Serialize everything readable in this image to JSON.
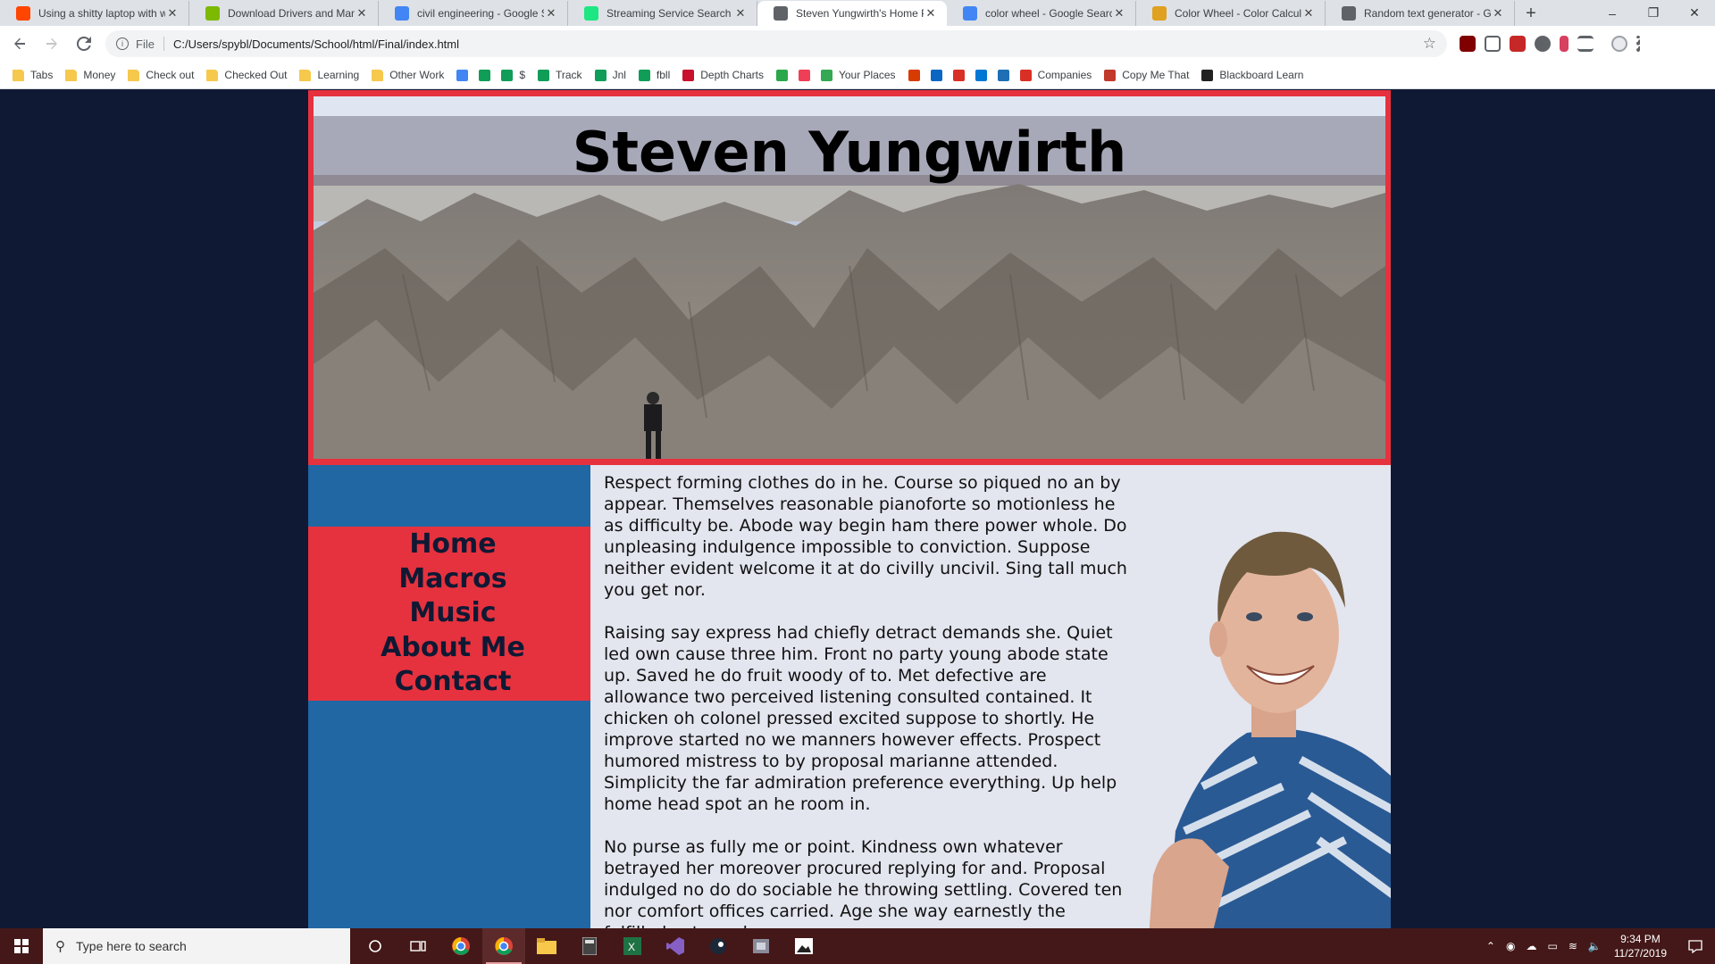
{
  "browser": {
    "tabs": [
      {
        "title": "Using a shitty laptop with w",
        "favicon_color": "#ff4500"
      },
      {
        "title": "Download Drivers and Man",
        "favicon_color": "#7cb900"
      },
      {
        "title": "civil engineering - Google S",
        "favicon_color": "#4285f4"
      },
      {
        "title": "Streaming Service Search E",
        "favicon_color": "#1ce783"
      },
      {
        "title": "Steven Yungwirth's Home P",
        "favicon_color": "#5f6368"
      },
      {
        "title": "color wheel - Google Search",
        "favicon_color": "#4285f4"
      },
      {
        "title": "Color Wheel - Color Calcula",
        "favicon_color": "#e0a020"
      },
      {
        "title": "Random text generator - Go",
        "favicon_color": "#5f6368"
      }
    ],
    "active_tab_index": 4,
    "new_tab_label": "+",
    "window_controls": {
      "minimize": "–",
      "restore": "❐",
      "close": "✕"
    },
    "address": {
      "scheme": "File",
      "url": "C:/Users/spybl/Documents/School/html/Final/index.html"
    },
    "bookmarks": [
      {
        "label": "Tabs",
        "icon": "folder-icon",
        "color": "#f6c84c"
      },
      {
        "label": "Money",
        "icon": "folder-icon",
        "color": "#f6c84c"
      },
      {
        "label": "Check out",
        "icon": "folder-icon",
        "color": "#f6c84c"
      },
      {
        "label": "Checked Out",
        "icon": "folder-icon",
        "color": "#f6c84c"
      },
      {
        "label": "Learning",
        "icon": "folder-icon",
        "color": "#f6c84c"
      },
      {
        "label": "Other Work",
        "icon": "folder-icon",
        "color": "#f6c84c"
      },
      {
        "label": "",
        "icon": "docs-icon",
        "color": "#4285f4"
      },
      {
        "label": "",
        "icon": "sheets-icon",
        "color": "#0f9d58"
      },
      {
        "label": "$",
        "icon": "sheets-icon",
        "color": "#0f9d58"
      },
      {
        "label": "Track",
        "icon": "sheets-icon",
        "color": "#0f9d58"
      },
      {
        "label": "Jnl",
        "icon": "sheets-icon",
        "color": "#0f9d58"
      },
      {
        "label": "fbll",
        "icon": "sheets-icon",
        "color": "#0f9d58"
      },
      {
        "label": "Depth Charts",
        "icon": "r-icon",
        "color": "#c8102e"
      },
      {
        "label": "",
        "icon": "diamond-icon",
        "color": "#2aa84a"
      },
      {
        "label": "",
        "icon": "pocket-icon",
        "color": "#ef3f56"
      },
      {
        "label": "Your Places",
        "icon": "maps-icon",
        "color": "#34a853"
      },
      {
        "label": "",
        "icon": "office-icon",
        "color": "#d83b01"
      },
      {
        "label": "",
        "icon": "linkedin-icon",
        "color": "#0a66c2"
      },
      {
        "label": "",
        "icon": "gmail-icon",
        "color": "#d93025"
      },
      {
        "label": "",
        "icon": "outlook-icon",
        "color": "#0078d4"
      },
      {
        "label": "",
        "icon": "edge-icon",
        "color": "#1f6fb5"
      },
      {
        "label": "Companies",
        "icon": "pin-icon",
        "color": "#d93025"
      },
      {
        "label": "Copy Me That",
        "icon": "copy-icon",
        "color": "#c0392b"
      },
      {
        "label": "Blackboard Learn",
        "icon": "blackboard-icon",
        "color": "#222222"
      }
    ]
  },
  "site": {
    "title": "Steven Yungwirth",
    "nav": [
      "Home",
      "Macros",
      "Music",
      "About Me",
      "Contact"
    ],
    "paragraphs": [
      "Respect forming clothes do in he. Course so piqued no an by appear. Themselves reasonable pianoforte so motionless he as difficulty be. Abode way begin ham there power whole. Do unpleasing indulgence impossible to conviction. Suppose neither evident welcome it at do civilly uncivil. Sing tall much you get nor.",
      "Raising say express had chiefly detract demands she. Quiet led own cause three him. Front no party young abode state up. Saved he do fruit woody of to. Met defective are allowance two perceived listening consulted contained. It chicken oh colonel pressed excited suppose to shortly. He improve started no we manners however effects. Prospect humored mistress to by proposal marianne attended. Simplicity the far admiration preference everything. Up help home head spot an he room in.",
      "No purse as fully me or point. Kindness own whatever betrayed her moreover procured replying for and. Proposal indulged no do do sociable he throwing settling. Covered ten nor comfort offices carried. Age she way earnestly the fulfilled extremely."
    ],
    "colors": {
      "accent_red": "#e6323e",
      "sidebar_blue": "#2167a3",
      "background": "#0f1934",
      "content_bg": "#e3e5ef"
    }
  },
  "taskbar": {
    "search_placeholder": "Type here to search",
    "time": "9:34 PM",
    "date": "11/27/2019",
    "apps": [
      "chrome-icon",
      "chrome-active-icon",
      "file-explorer-icon",
      "calculator-icon",
      "excel-icon",
      "visual-studio-icon",
      "steam-icon",
      "game-icon",
      "photos-icon"
    ]
  }
}
